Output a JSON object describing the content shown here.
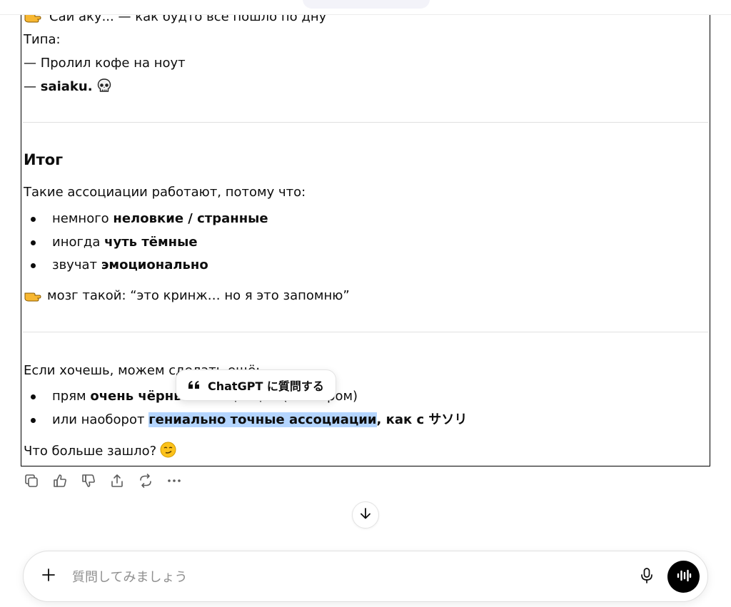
{
  "message": {
    "line_cut_prefix": "Саи аку...",
    "line_cut_suffix": " — как будто всё пошло по дну",
    "type_label": "Типа:",
    "dash_item_1": "— Пролил кофе на ноут",
    "dash_item_2_prefix": "— ",
    "dash_item_2_bold": "saiaku.",
    "summary_heading": "Итог",
    "summary_intro": "Такие ассоциации работают, потому что:",
    "bullets": [
      {
        "plain": "немного ",
        "bold": "неловкие / странные"
      },
      {
        "plain": "иногда ",
        "bold": "чуть тёмные"
      },
      {
        "plain": "звучат ",
        "bold": "эмоционально"
      }
    ],
    "brain_line": "мозг такой: “это кринж… но я это запомню”",
    "offer_intro": "Если хочешь, можем сделать ещё:",
    "offer_bullets": [
      {
        "plain": "прям ",
        "bold": "очень чёрные",
        "rest": " ассоциации (с юмором)"
      },
      {
        "plain": "или наоборот ",
        "selected": "гениально точные ассоциации",
        "bold_rest": ", как с サソリ"
      }
    ],
    "closing": "Что больше зашло?"
  },
  "tooltip": {
    "label": "ChatGPT に質問する",
    "icon": "quote-icon"
  },
  "actions": [
    {
      "name": "copy-button",
      "icon": "copy-icon"
    },
    {
      "name": "good-response-button",
      "icon": "thumbs-up-icon"
    },
    {
      "name": "bad-response-button",
      "icon": "thumbs-down-icon"
    },
    {
      "name": "share-button",
      "icon": "share-icon"
    },
    {
      "name": "regenerate-button",
      "icon": "refresh-icon"
    },
    {
      "name": "more-actions-button",
      "icon": "more-icon"
    }
  ],
  "composer": {
    "placeholder": "質問してみましょう",
    "value": ""
  },
  "colors": {
    "selection": "#b4d5fe",
    "text": "#0d0d0d",
    "voice_button": "#000000"
  }
}
